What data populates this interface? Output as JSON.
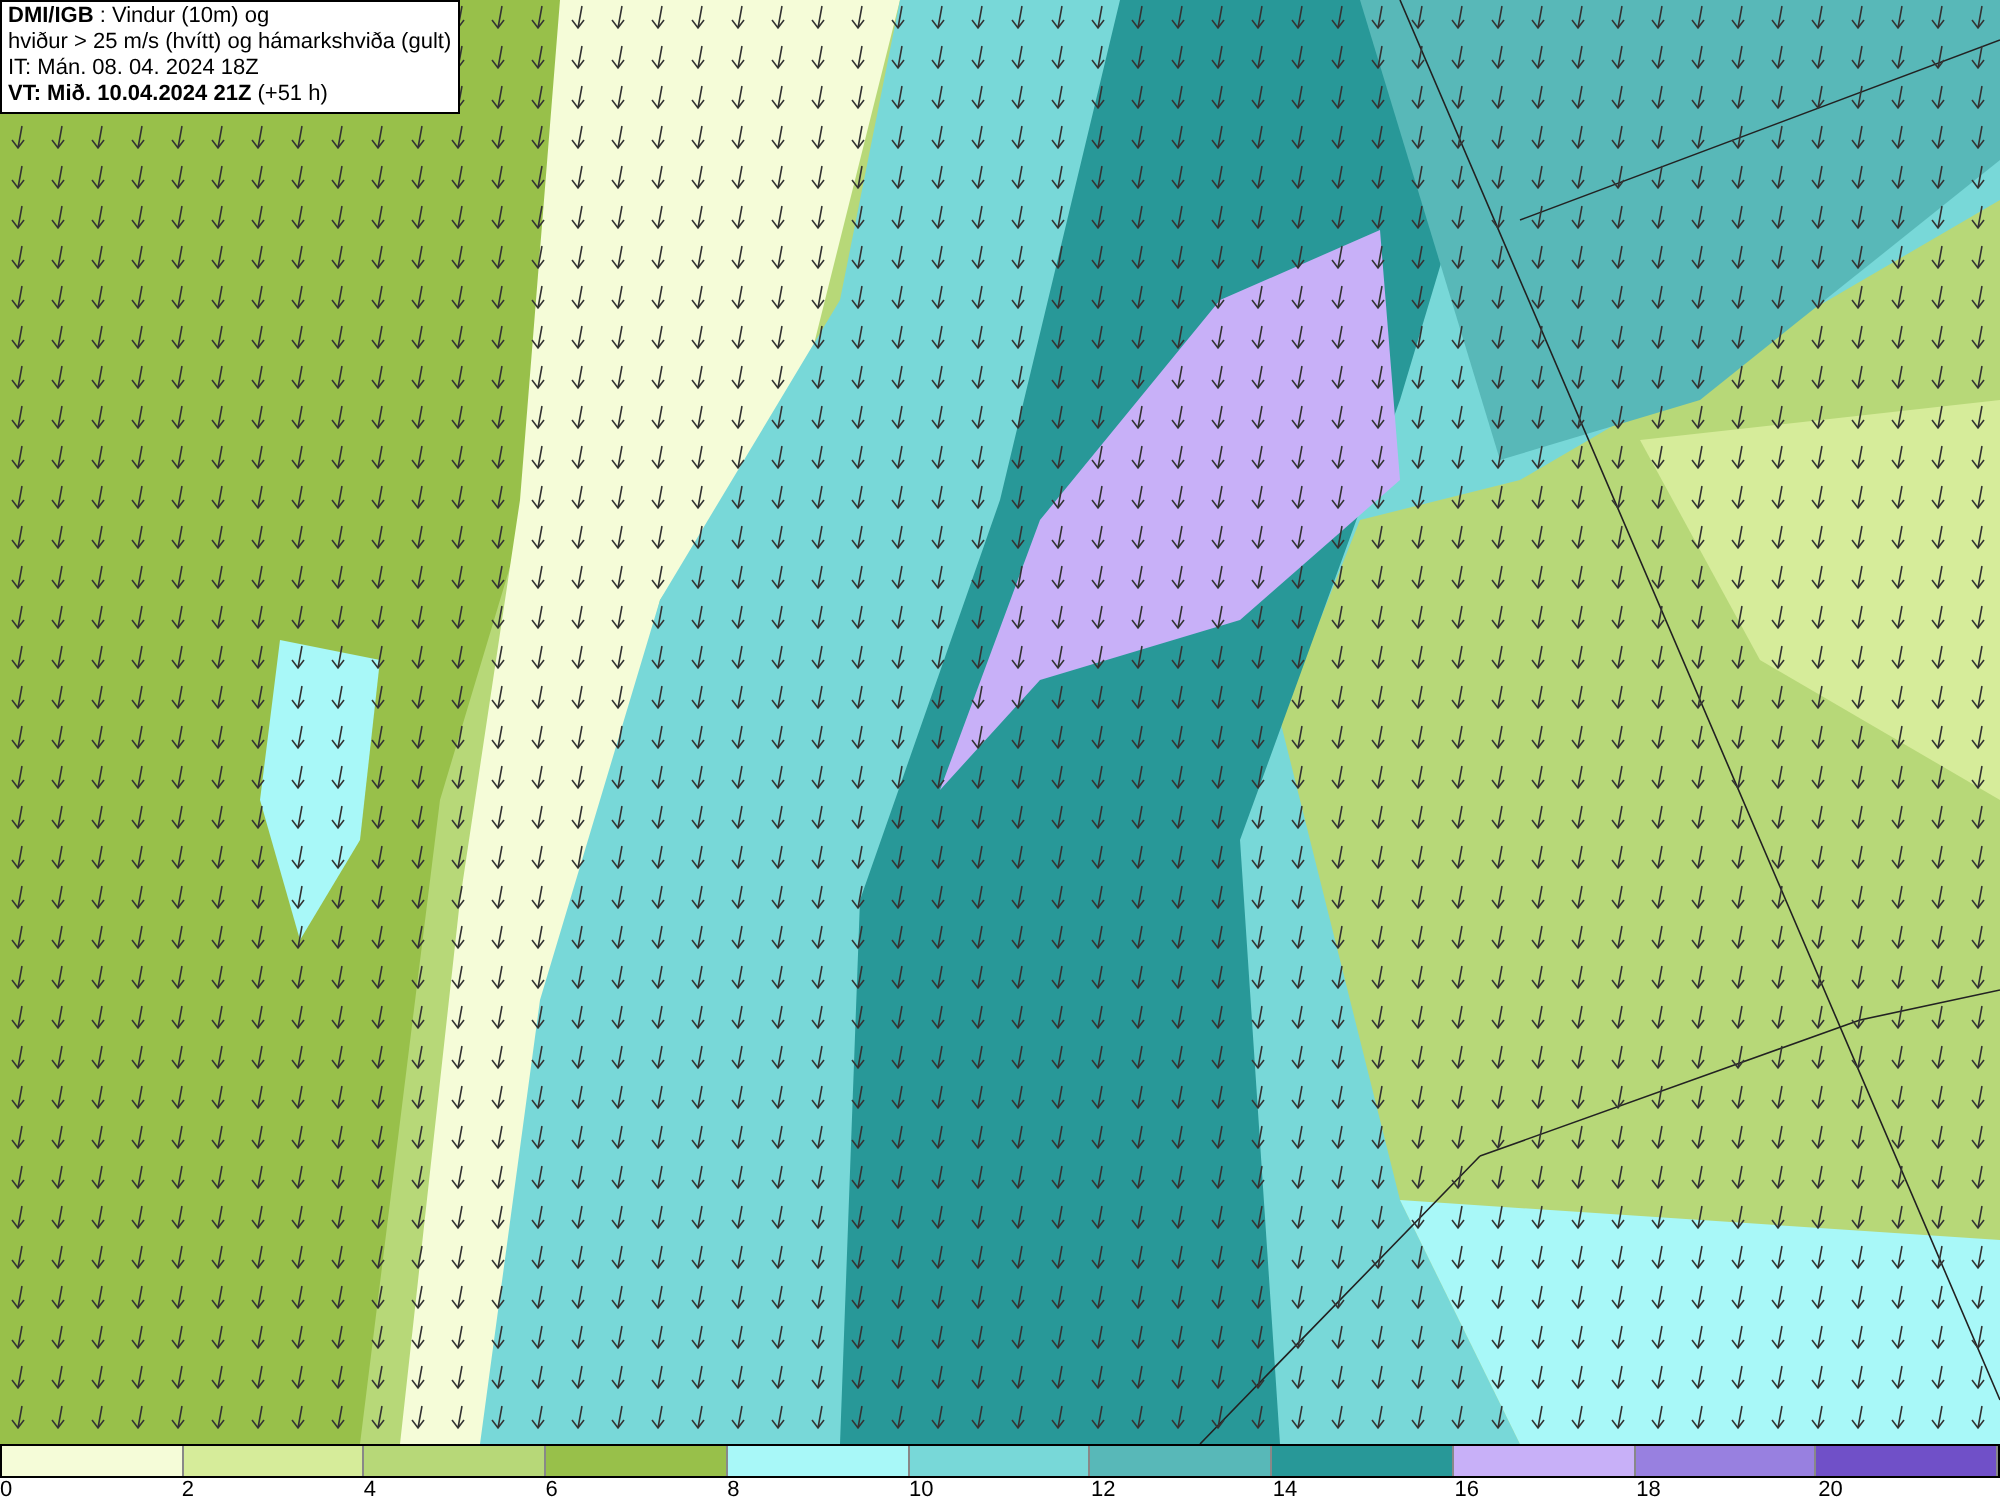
{
  "info_box": {
    "lines": [
      "**DMI/IGB** : Vindur (10m) og",
      "hviður > 25 m/s (hvítt) og hámarkshviða (gult)",
      "IT: Mán. 08. 04. 2024 18Z",
      "**VT: Mið. 10.04.2024 21Z** (+51 h)"
    ]
  },
  "legend": {
    "bins": [
      {
        "color": "#f5fcd8"
      },
      {
        "color": "#d6ec9a"
      },
      {
        "color": "#b7d878"
      },
      {
        "color": "#98c04a"
      },
      {
        "color": "#a8f8f8"
      },
      {
        "color": "#78d8d8"
      },
      {
        "color": "#58b8b8"
      },
      {
        "color": "#289898"
      },
      {
        "color": "#c8b0f8"
      },
      {
        "color": "#9880e0"
      },
      {
        "color": "#7050c8"
      }
    ],
    "ticks": [
      "0",
      "2",
      "4",
      "6",
      "8",
      "10",
      "12",
      "14",
      "16",
      "18",
      "20"
    ]
  }
}
